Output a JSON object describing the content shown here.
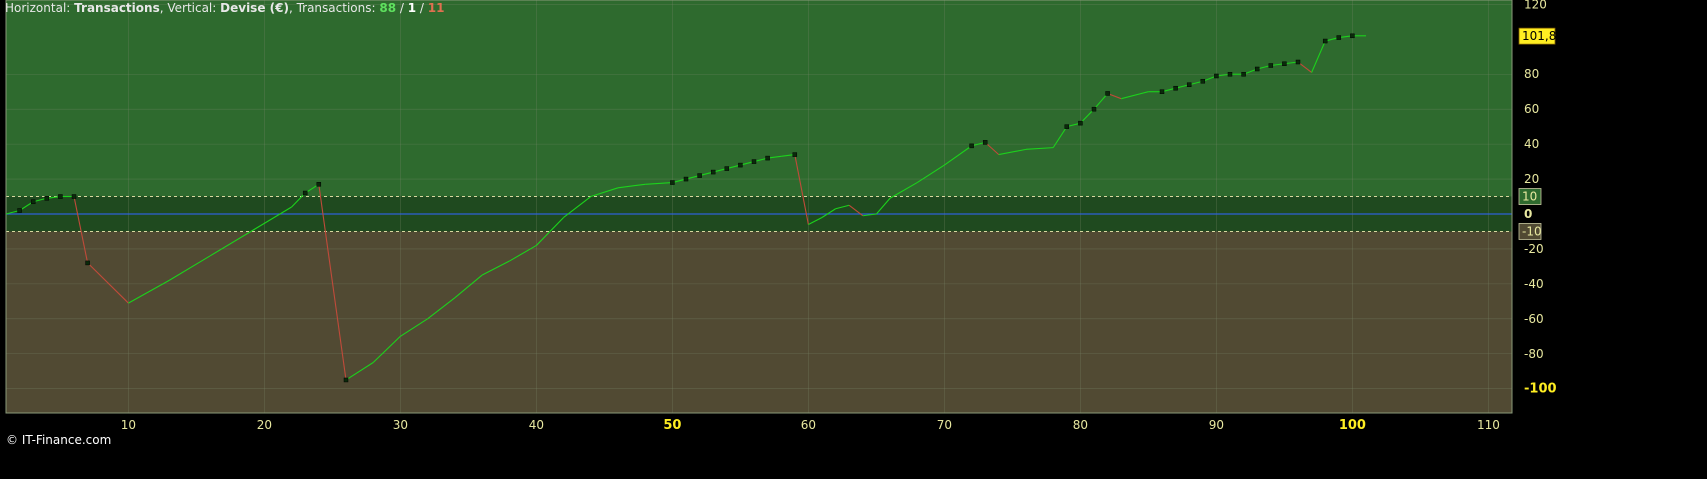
{
  "header": {
    "h_label": "Horizontal:",
    "h_value": "Transactions",
    "v_label": ", Vertical:",
    "v_value": "Devise (€)",
    "t_label": ", Transactions:",
    "wins": "88",
    "sep1": " / ",
    "neutral": "1",
    "sep2": " / ",
    "losses": "11"
  },
  "copyright": "© IT-Finance.com",
  "colors": {
    "bg": "#000000",
    "upper_zone": "#2e6a2e",
    "band_zone": "#1f4a1f",
    "lower_zone": "#514a33",
    "grid": "#7a8a6a",
    "zero_line": "#2f62d8",
    "band_line": "#d8d8a0",
    "gain": "#1cd21c",
    "loss": "#c04a3a",
    "marker": "#0a2a0a",
    "label_highlight": "#ffee22"
  },
  "chart_data": {
    "type": "line",
    "xlabel": "Transactions",
    "ylabel": "Devise (€)",
    "xlim": [
      1,
      111
    ],
    "ylim": [
      -110,
      120
    ],
    "x_ticks": [
      10,
      20,
      30,
      40,
      50,
      60,
      70,
      80,
      90,
      100,
      110
    ],
    "x_ticks_highlight": [
      50,
      100
    ],
    "y_ticks": [
      120,
      80,
      60,
      40,
      20,
      0,
      -20,
      -40,
      -60,
      -80,
      -100
    ],
    "y_ticks_highlight": [
      -100
    ],
    "band": [
      -10,
      10
    ],
    "band_labels": [
      "10",
      "-10"
    ],
    "last_value_label": "101,8",
    "last_value": 101.8,
    "grid": true,
    "series": [
      {
        "x": [
          1,
          2,
          3,
          4,
          5,
          6,
          7,
          10,
          13,
          16,
          19,
          22,
          23,
          24,
          26,
          28,
          30,
          32,
          34,
          36,
          38,
          40,
          42,
          44,
          46,
          48,
          50,
          51,
          52,
          53,
          54,
          55,
          56,
          57,
          58,
          59,
          60,
          61,
          62,
          63,
          64,
          65,
          66,
          68,
          70,
          72,
          73,
          74,
          76,
          78,
          79,
          80,
          81,
          82,
          83,
          85,
          86,
          87,
          88,
          89,
          90,
          91,
          92,
          93,
          94,
          95,
          96,
          97,
          98,
          99,
          100,
          101
        ],
        "y": [
          0,
          2,
          7,
          9,
          10,
          10,
          -28,
          -51,
          -38,
          -24,
          -10,
          4,
          12,
          17,
          -95,
          -85,
          -70,
          -60,
          -48,
          -35,
          -27,
          -18,
          -2,
          10,
          15,
          17,
          18,
          20,
          22,
          24,
          26,
          28,
          30,
          32,
          33,
          34,
          -6,
          -2,
          3,
          5,
          -1,
          0,
          9,
          18,
          28,
          39,
          41,
          34,
          37,
          38,
          50,
          52,
          60,
          69,
          66,
          70,
          70,
          72,
          74,
          76,
          79,
          80,
          80,
          83,
          85,
          86,
          87,
          81,
          99,
          101,
          102,
          102
        ],
        "markers": [
          2,
          3,
          4,
          5,
          6,
          7,
          23,
          24,
          26,
          50,
          51,
          52,
          53,
          54,
          55,
          56,
          57,
          59,
          72,
          73,
          79,
          80,
          81,
          82,
          86,
          87,
          88,
          89,
          90,
          91,
          92,
          93,
          94,
          95,
          96,
          98,
          99,
          100
        ]
      }
    ]
  }
}
